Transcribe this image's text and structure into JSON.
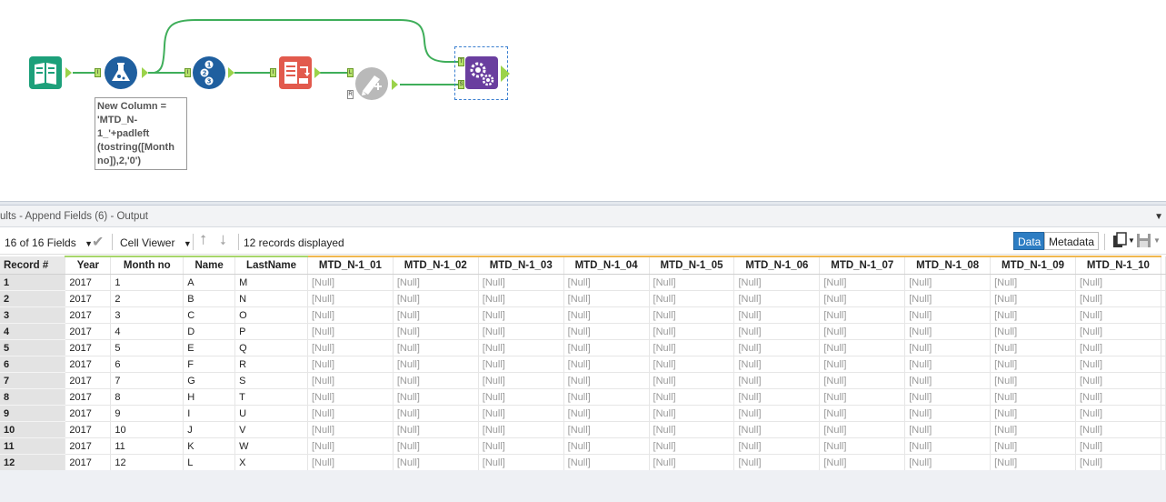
{
  "workflow": {
    "annotation": "New Column =\n'MTD_N-\n1_'+padleft\n(tostring([Month\nno]),2,'0')",
    "anchors": {
      "in": "I",
      "out": "O",
      "left": "L",
      "right": "R",
      "target": "T",
      "source": "S"
    }
  },
  "results": {
    "title": "ults - Append Fields (6) - Output",
    "fields_selector": "16 of 16 Fields",
    "cell_viewer_label": "Cell Viewer",
    "records_status": "12 records displayed",
    "data_tab": "Data",
    "metadata_tab": "Metadata"
  },
  "table": {
    "columns": [
      "Record #",
      "Year",
      "Month no",
      "Name",
      "LastName",
      "MTD_N-1_01",
      "MTD_N-1_02",
      "MTD_N-1_03",
      "MTD_N-1_04",
      "MTD_N-1_05",
      "MTD_N-1_06",
      "MTD_N-1_07",
      "MTD_N-1_08",
      "MTD_N-1_09",
      "MTD_N-1_10"
    ],
    "rows": [
      [
        "1",
        "2017",
        "1",
        "A",
        "M",
        "[Null]",
        "[Null]",
        "[Null]",
        "[Null]",
        "[Null]",
        "[Null]",
        "[Null]",
        "[Null]",
        "[Null]",
        "[Null]"
      ],
      [
        "2",
        "2017",
        "2",
        "B",
        "N",
        "[Null]",
        "[Null]",
        "[Null]",
        "[Null]",
        "[Null]",
        "[Null]",
        "[Null]",
        "[Null]",
        "[Null]",
        "[Null]"
      ],
      [
        "3",
        "2017",
        "3",
        "C",
        "O",
        "[Null]",
        "[Null]",
        "[Null]",
        "[Null]",
        "[Null]",
        "[Null]",
        "[Null]",
        "[Null]",
        "[Null]",
        "[Null]"
      ],
      [
        "4",
        "2017",
        "4",
        "D",
        "P",
        "[Null]",
        "[Null]",
        "[Null]",
        "[Null]",
        "[Null]",
        "[Null]",
        "[Null]",
        "[Null]",
        "[Null]",
        "[Null]"
      ],
      [
        "5",
        "2017",
        "5",
        "E",
        "Q",
        "[Null]",
        "[Null]",
        "[Null]",
        "[Null]",
        "[Null]",
        "[Null]",
        "[Null]",
        "[Null]",
        "[Null]",
        "[Null]"
      ],
      [
        "6",
        "2017",
        "6",
        "F",
        "R",
        "[Null]",
        "[Null]",
        "[Null]",
        "[Null]",
        "[Null]",
        "[Null]",
        "[Null]",
        "[Null]",
        "[Null]",
        "[Null]"
      ],
      [
        "7",
        "2017",
        "7",
        "G",
        "S",
        "[Null]",
        "[Null]",
        "[Null]",
        "[Null]",
        "[Null]",
        "[Null]",
        "[Null]",
        "[Null]",
        "[Null]",
        "[Null]"
      ],
      [
        "8",
        "2017",
        "8",
        "H",
        "T",
        "[Null]",
        "[Null]",
        "[Null]",
        "[Null]",
        "[Null]",
        "[Null]",
        "[Null]",
        "[Null]",
        "[Null]",
        "[Null]"
      ],
      [
        "9",
        "2017",
        "9",
        "I",
        "U",
        "[Null]",
        "[Null]",
        "[Null]",
        "[Null]",
        "[Null]",
        "[Null]",
        "[Null]",
        "[Null]",
        "[Null]",
        "[Null]"
      ],
      [
        "10",
        "2017",
        "10",
        "J",
        "V",
        "[Null]",
        "[Null]",
        "[Null]",
        "[Null]",
        "[Null]",
        "[Null]",
        "[Null]",
        "[Null]",
        "[Null]",
        "[Null]"
      ],
      [
        "11",
        "2017",
        "11",
        "K",
        "W",
        "[Null]",
        "[Null]",
        "[Null]",
        "[Null]",
        "[Null]",
        "[Null]",
        "[Null]",
        "[Null]",
        "[Null]",
        "[Null]"
      ],
      [
        "12",
        "2017",
        "12",
        "L",
        "X",
        "[Null]",
        "[Null]",
        "[Null]",
        "[Null]",
        "[Null]",
        "[Null]",
        "[Null]",
        "[Null]",
        "[Null]",
        "[Null]"
      ]
    ]
  },
  "colors": {
    "accent": "#2d7dc3",
    "connector": "#3fae5a",
    "anchor": "#b4e06a",
    "new_field": "#f0b850"
  }
}
